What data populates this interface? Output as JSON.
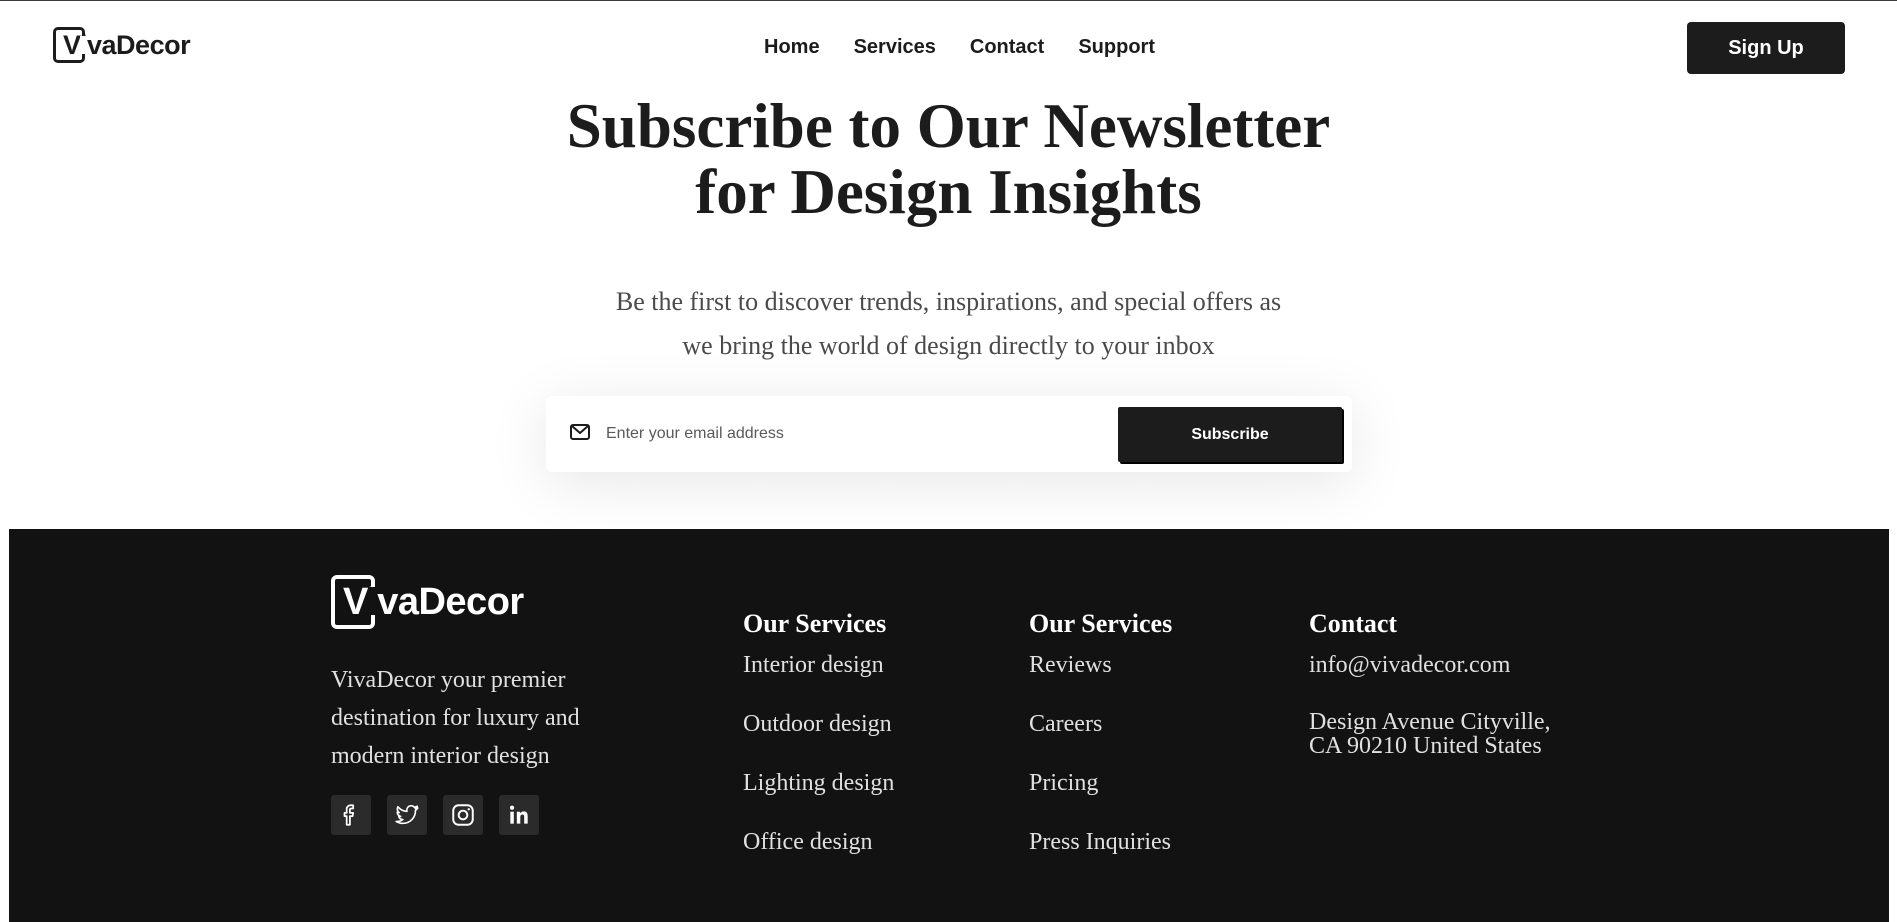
{
  "brand": {
    "name": "VivaDecor"
  },
  "nav": {
    "items": [
      {
        "label": "Home"
      },
      {
        "label": "Services"
      },
      {
        "label": "Contact"
      },
      {
        "label": "Support"
      }
    ],
    "signup_label": "Sign Up"
  },
  "hero": {
    "title_line1": "Subscribe to Our Newsletter",
    "title_line2": "for Design Insights",
    "subtitle_line1": "Be the first to discover trends, inspirations, and special offers as",
    "subtitle_line2": "we bring the world of design directly to your inbox"
  },
  "subscribe": {
    "email_placeholder": "Enter your email address",
    "email_value": "",
    "button_label": "Subscribe",
    "icon": "mail-icon"
  },
  "footer": {
    "brand": "VivaDecor",
    "description": "VivaDecor your premier destination for luxury and modern interior design",
    "socials": [
      {
        "icon": "facebook-icon"
      },
      {
        "icon": "twitter-icon"
      },
      {
        "icon": "instagram-icon"
      },
      {
        "icon": "linkedin-icon"
      }
    ],
    "columns": [
      {
        "heading": "Our Services",
        "items": [
          "Interior design",
          "Outdoor design",
          "Lighting design",
          "Office design"
        ]
      },
      {
        "heading": "Our Services",
        "items": [
          "Reviews",
          "Careers",
          "Pricing",
          "Press Inquiries"
        ]
      }
    ],
    "contact": {
      "heading": "Contact",
      "email": "info@vivadecor.com",
      "address_line1": "Design Avenue Cityville,",
      "address_line2": "CA 90210 United States"
    }
  },
  "colors": {
    "primary": "#1c1c1c",
    "footer_bg": "#121212",
    "white": "#ffffff"
  }
}
